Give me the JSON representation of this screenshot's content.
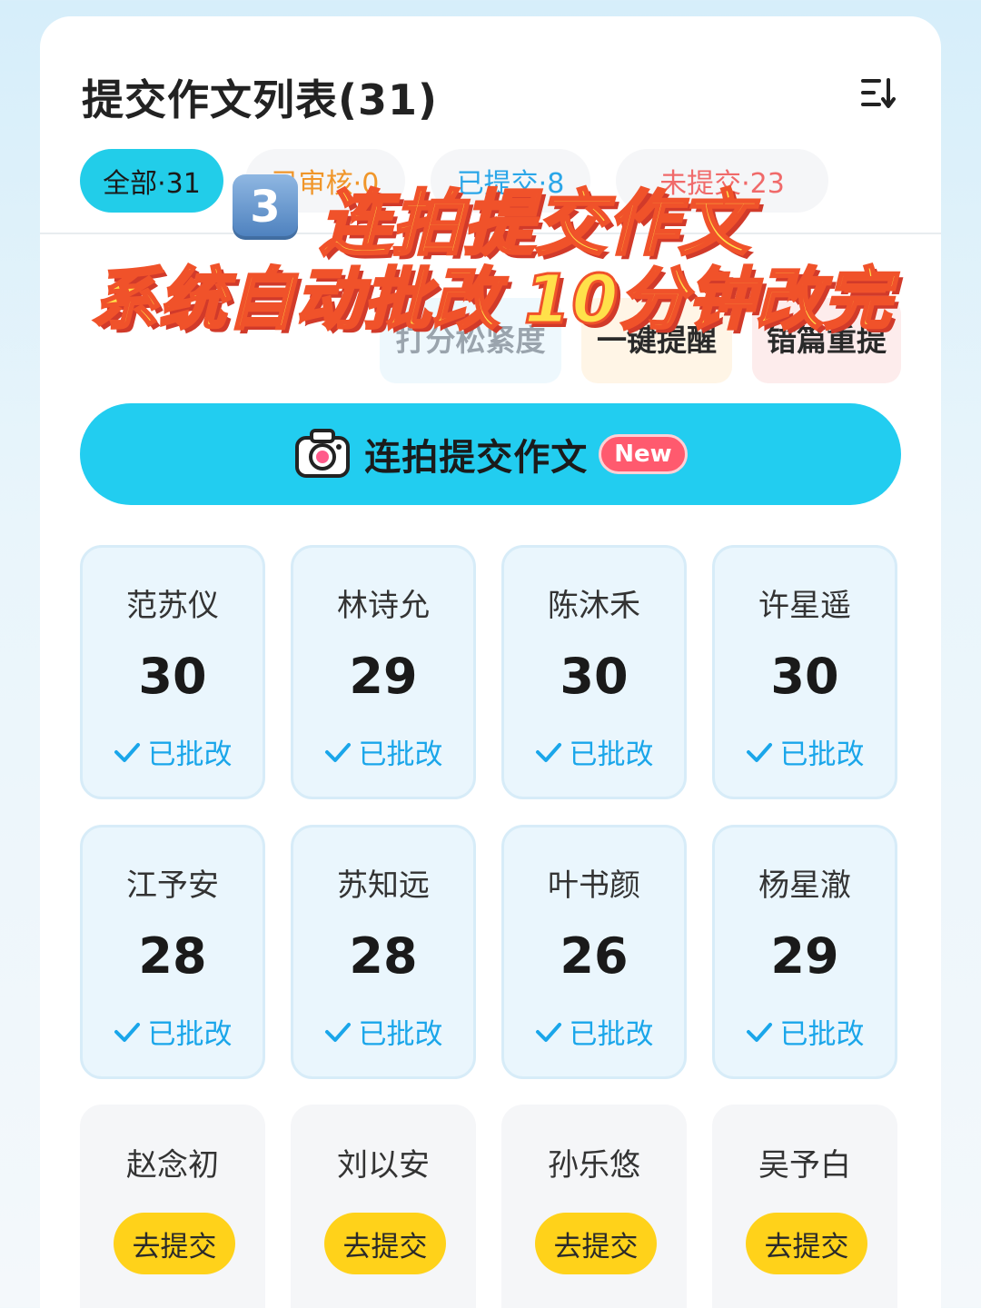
{
  "header": {
    "title": "提交作文列表(31)"
  },
  "tabs": [
    {
      "label": "全部·31"
    },
    {
      "label": "已审核·0"
    },
    {
      "label": "已提交·8"
    },
    {
      "label": "未提交·23"
    }
  ],
  "actions": [
    {
      "label": "打分松紧度"
    },
    {
      "label": "一键提醒"
    },
    {
      "label": "错篇重提"
    }
  ],
  "shoot_button": {
    "label": "连拍提交作文",
    "badge": "New"
  },
  "overlay": {
    "step": "3",
    "line1": "连拍提交作文",
    "line2": "系统自动批改 10分钟改完"
  },
  "students": [
    {
      "name": "范苏仪",
      "score": "30",
      "status": "已批改"
    },
    {
      "name": "林诗允",
      "score": "29",
      "status": "已批改"
    },
    {
      "name": "陈沐禾",
      "score": "30",
      "status": "已批改"
    },
    {
      "name": "许星遥",
      "score": "30",
      "status": "已批改"
    },
    {
      "name": "江予安",
      "score": "28",
      "status": "已批改"
    },
    {
      "name": "苏知远",
      "score": "28",
      "status": "已批改"
    },
    {
      "name": "叶书颜",
      "score": "26",
      "status": "已批改"
    },
    {
      "name": "杨星澈",
      "score": "29",
      "status": "已批改"
    },
    {
      "name": "赵念初",
      "action": "去提交"
    },
    {
      "name": "刘以安",
      "action": "去提交"
    },
    {
      "name": "孙乐悠",
      "action": "去提交"
    },
    {
      "name": "吴予白",
      "action": "去提交"
    }
  ],
  "colors": {
    "accent": "#22cdf0",
    "checked": "#1aa6ea",
    "submit": "#ffd21a",
    "badge": "#ff5a6e"
  }
}
